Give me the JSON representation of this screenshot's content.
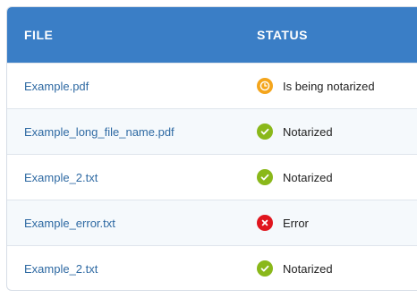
{
  "table": {
    "headers": {
      "file": "FILE",
      "status": "STATUS"
    },
    "rows": [
      {
        "file": "Example.pdf",
        "status": "Is being notarized",
        "icon": "clock-icon",
        "color": "#f4a51c"
      },
      {
        "file": "Example_long_file_name.pdf",
        "status": "Notarized",
        "icon": "check-icon",
        "color": "#8ab81a"
      },
      {
        "file": "Example_2.txt",
        "status": "Notarized",
        "icon": "check-icon",
        "color": "#8ab81a"
      },
      {
        "file": "Example_error.txt",
        "status": "Error",
        "icon": "error-icon",
        "color": "#e0161e"
      },
      {
        "file": "Example_2.txt",
        "status": "Notarized",
        "icon": "check-icon",
        "color": "#8ab81a"
      }
    ]
  },
  "colors": {
    "header_bg": "#3a7ec6",
    "link": "#2f6aa3",
    "alt_row": "#f5f9fc"
  }
}
